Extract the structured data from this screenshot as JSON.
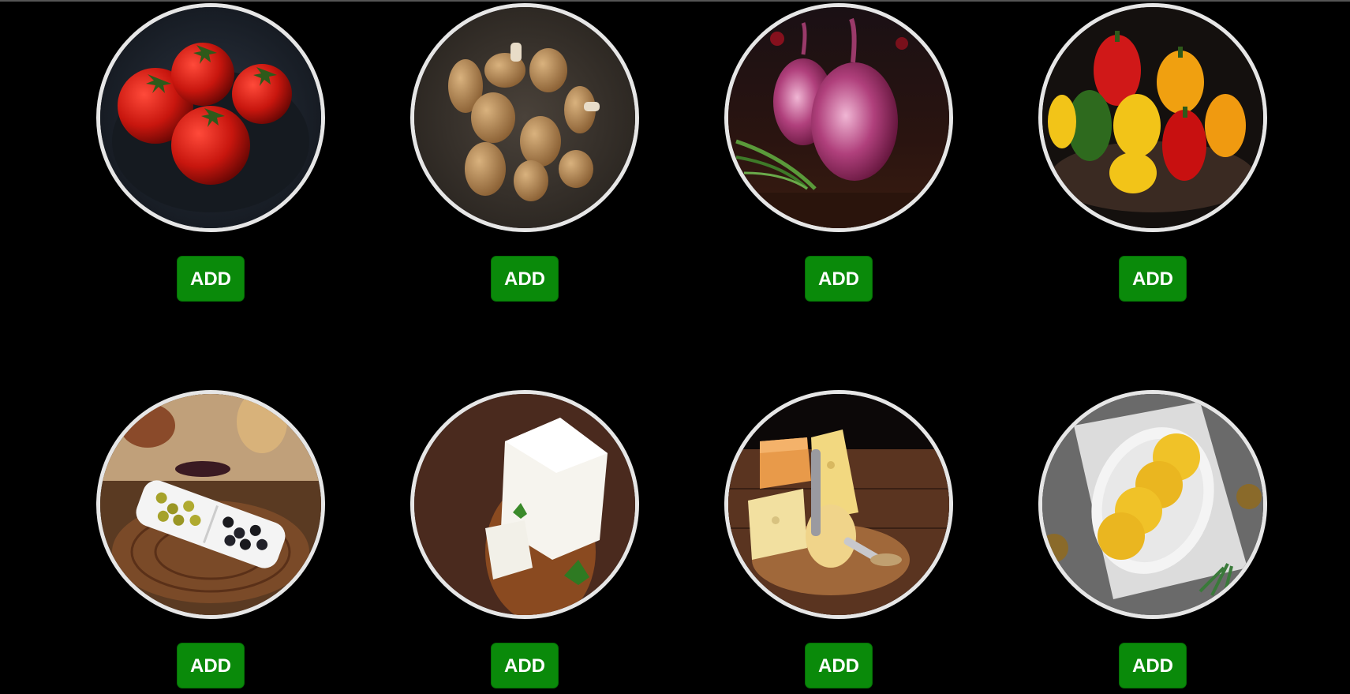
{
  "colors": {
    "background": "#000000",
    "button": "#0a8a0a",
    "button_text": "#ffffff",
    "ring": "#e6e6e6"
  },
  "products": [
    {
      "image": "tomatoes-photo",
      "button_label": "ADD"
    },
    {
      "image": "mushrooms-photo",
      "button_label": "ADD"
    },
    {
      "image": "red-onions-photo",
      "button_label": "ADD"
    },
    {
      "image": "bell-peppers-photo",
      "button_label": "ADD"
    },
    {
      "image": "olives-photo",
      "button_label": "ADD"
    },
    {
      "image": "feta-cheese-photo",
      "button_label": "ADD"
    },
    {
      "image": "cheese-board-photo",
      "button_label": "ADD"
    },
    {
      "image": "pineapple-slices-photo",
      "button_label": "ADD"
    }
  ]
}
